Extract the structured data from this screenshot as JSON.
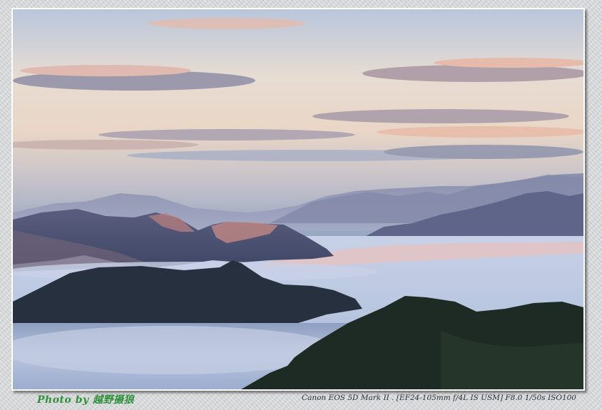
{
  "image": {
    "alt": "Sunrise over mountain ridges rising above a sea of clouds"
  },
  "watermark": {
    "signature": "Photo by 越野摄狼",
    "exif": "Canon EOS 5D Mark II . [EF24-105mm f/4L IS USM] F8.0 1/50s ISO100"
  }
}
